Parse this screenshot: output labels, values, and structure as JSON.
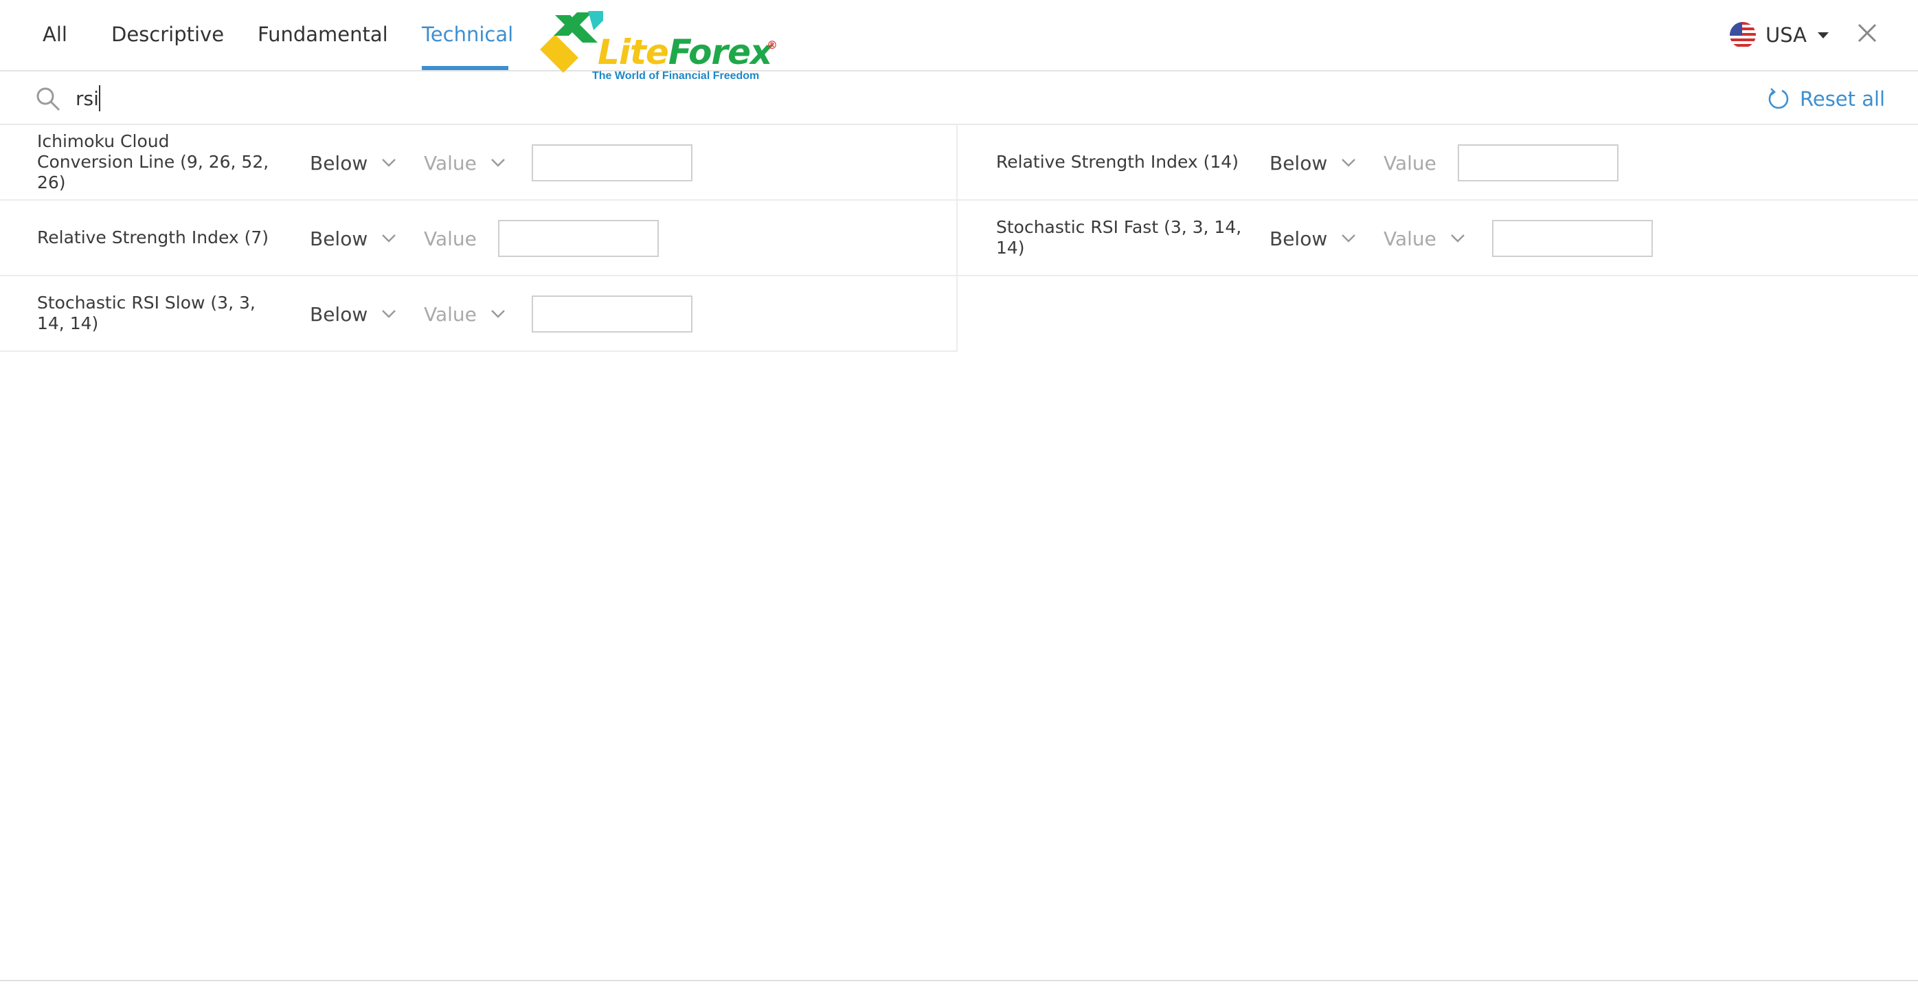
{
  "tabs": [
    {
      "label": "All",
      "active": false
    },
    {
      "label": "Descriptive",
      "active": false
    },
    {
      "label": "Fundamental",
      "active": false
    },
    {
      "label": "Technical",
      "active": true
    }
  ],
  "logo": {
    "lite": "Lite",
    "forex": "Forex",
    "registered": "®",
    "tagline": "The World of Financial Freedom"
  },
  "country": {
    "label": "USA",
    "flag": "us-flag-icon"
  },
  "search": {
    "value": "rsi",
    "placeholder": ""
  },
  "reset": {
    "label": "Reset all"
  },
  "filters": [
    {
      "name": "Ichimoku Cloud Conversion Line (9, 26, 52, 26)",
      "operator": "Below",
      "value_label": "Value",
      "value_dropdown": true,
      "input": ""
    },
    {
      "name": "Relative Strength Index (14)",
      "operator": "Below",
      "value_label": "Value",
      "value_dropdown": false,
      "input": ""
    },
    {
      "name": "Relative Strength Index (7)",
      "operator": "Below",
      "value_label": "Value",
      "value_dropdown": false,
      "input": ""
    },
    {
      "name": "Stochastic RSI Fast (3, 3, 14, 14)",
      "operator": "Below",
      "value_label": "Value",
      "value_dropdown": true,
      "input": ""
    },
    {
      "name": "Stochastic RSI Slow (3, 3, 14, 14)",
      "operator": "Below",
      "value_label": "Value",
      "value_dropdown": true,
      "input": ""
    }
  ],
  "colors": {
    "accent": "#3d8fd1",
    "logo_yellow": "#f5c518",
    "logo_green": "#1fa84a",
    "muted_text": "#a9a9a9"
  }
}
